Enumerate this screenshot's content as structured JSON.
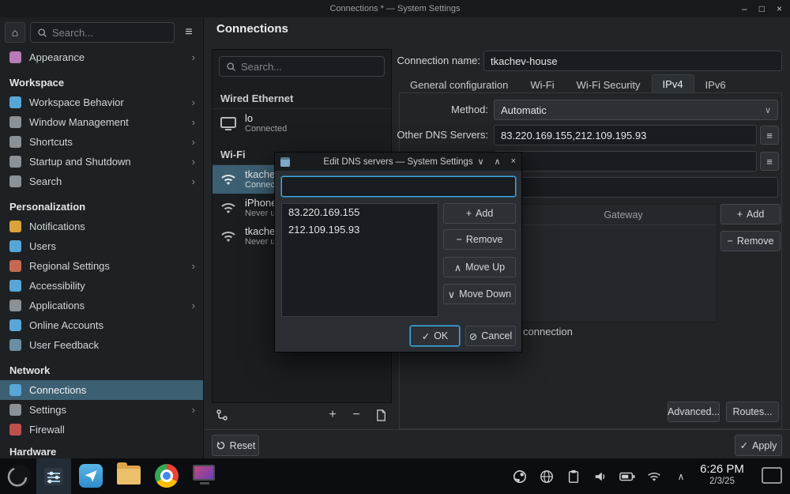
{
  "accent_color": "#3daee9",
  "selection_color": "#3c5f72",
  "window": {
    "title": "Connections * — System Settings",
    "controls": {
      "minimize": "–",
      "maximize": "□",
      "close": "×"
    }
  },
  "icons": {
    "home": "⌂",
    "hamburger": "≡",
    "chevron_right": "›",
    "chevron_down": "∨",
    "chevron_up": "∧",
    "close": "×",
    "plus": "+",
    "minus": "−",
    "check": "✓",
    "cancel_glyph": "⊘",
    "edit_list": "≡"
  },
  "sidebar": {
    "search_placeholder": "Search...",
    "appearance": {
      "label": "Appearance"
    },
    "groups": [
      {
        "title": "Workspace",
        "items": [
          {
            "label": "Workspace Behavior"
          },
          {
            "label": "Window Management"
          },
          {
            "label": "Shortcuts"
          },
          {
            "label": "Startup and Shutdown"
          },
          {
            "label": "Search"
          }
        ]
      },
      {
        "title": "Personalization",
        "items": [
          {
            "label": "Notifications"
          },
          {
            "label": "Users"
          },
          {
            "label": "Regional Settings"
          },
          {
            "label": "Accessibility"
          },
          {
            "label": "Applications"
          },
          {
            "label": "Online Accounts"
          },
          {
            "label": "User Feedback"
          }
        ]
      },
      {
        "title": "Network",
        "items": [
          {
            "label": "Connections"
          },
          {
            "label": "Settings"
          },
          {
            "label": "Firewall"
          }
        ]
      },
      {
        "title": "Hardware",
        "items": []
      }
    ]
  },
  "content": {
    "page_title": "Connections",
    "list": {
      "search_placeholder": "Search...",
      "wired_group_title": "Wired Ethernet",
      "wired_items": [
        {
          "name": "lo",
          "status": "Connected"
        }
      ],
      "wifi_group_title": "Wi-Fi",
      "wifi_items": [
        {
          "name": "tkachev",
          "status": "Connected"
        },
        {
          "name": "iPhone",
          "status": "Never used"
        },
        {
          "name": "tkachev",
          "status": "Never used"
        }
      ]
    },
    "details": {
      "connection_name_label": "Connection name:",
      "connection_name_value": "tkachev-house",
      "tabs": [
        {
          "label": "General configuration"
        },
        {
          "label": "Wi-Fi"
        },
        {
          "label": "Wi-Fi Security"
        },
        {
          "label": "IPv4"
        },
        {
          "label": "IPv6"
        }
      ],
      "active_tab": "IPv4",
      "method_label": "Method:",
      "method_value": "Automatic",
      "dns_label": "Other DNS Servers:",
      "dns_value": "83.220.169.155,212.109.195.93",
      "table": {
        "gateway_header": "Gateway"
      },
      "add_label": "Add",
      "remove_label": "Remove",
      "required_fragment": "connection",
      "advanced_label": "Advanced...",
      "routes_label": "Routes...",
      "reset_label": "Reset",
      "apply_label": "Apply"
    }
  },
  "dialog": {
    "title": "Edit DNS servers — System Settings",
    "input_value": "",
    "items": [
      "83.220.169.155",
      "212.109.195.93"
    ],
    "add_label": "Add",
    "remove_label": "Remove",
    "move_up_label": "Move Up",
    "move_down_label": "Move Down",
    "ok_label": "OK",
    "cancel_label": "Cancel"
  },
  "taskbar": {
    "clock_time": "6:26 PM",
    "clock_date": "2/3/25"
  }
}
